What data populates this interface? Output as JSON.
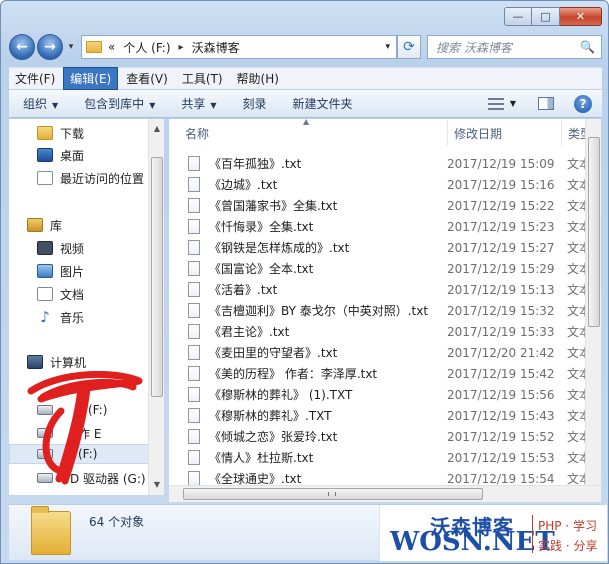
{
  "window": {
    "caption_buttons": [
      "—",
      "□",
      "✕"
    ]
  },
  "address": {
    "back": "←",
    "forward": "→",
    "history": "▾",
    "prefix": "«",
    "segments": [
      "个人 (F:)",
      "沃森博客"
    ],
    "separator": "▸",
    "dropdown": "▾",
    "refresh": "⟳"
  },
  "search": {
    "placeholder": "搜索 沃森博客",
    "icon": "🔍"
  },
  "menubar": {
    "items": [
      "文件(F)",
      "编辑(E)",
      "查看(V)",
      "工具(T)",
      "帮助(H)"
    ],
    "active_index": 1
  },
  "toolbar": {
    "items": [
      {
        "label": "组织",
        "arrow": "▼"
      },
      {
        "label": "包含到库中",
        "arrow": "▼"
      },
      {
        "label": "共享",
        "arrow": "▼"
      },
      {
        "label": "刻录",
        "arrow": ""
      },
      {
        "label": "新建文件夹",
        "arrow": ""
      }
    ],
    "view_arrow": "▼",
    "help_label": "?"
  },
  "nav": {
    "items": [
      {
        "label": "下载",
        "icon": "folder-icon",
        "group": "favorites"
      },
      {
        "label": "桌面",
        "icon": "desktop-icon",
        "group": "favorites"
      },
      {
        "label": "最近访问的位置",
        "icon": "recent-icon",
        "group": "favorites"
      },
      {
        "label": "库",
        "icon": "library-icon",
        "group": "libraries"
      },
      {
        "label": "视频",
        "icon": "video-icon",
        "group": "libraries"
      },
      {
        "label": "图片",
        "icon": "picture-icon",
        "group": "libraries"
      },
      {
        "label": "文档",
        "icon": "document-icon",
        "group": "libraries"
      },
      {
        "label": "音乐",
        "icon": "music-icon",
        "group": "libraries"
      },
      {
        "label": "计算机",
        "icon": "computer-icon",
        "group": "computer"
      },
      {
        "label": "本地磁盘 (C:)",
        "icon": "drive-icon",
        "group": "computer"
      },
      {
        "label": "工作 (E:)",
        "icon": "drive-icon",
        "group": "computer"
      },
      {
        "label": "个人 (F:)",
        "icon": "drive-icon",
        "group": "computer",
        "selected": true
      },
      {
        "label": "CD 驱动器 (G:)",
        "icon": "cd-drive-icon",
        "group": "computer"
      }
    ],
    "visible_fragments": [
      "(F:)",
      "作 E",
      "(F:)",
      "D 驱动器 (G:)"
    ]
  },
  "columns": {
    "name": "名称",
    "modified": "修改日期",
    "type": "类型"
  },
  "files": [
    {
      "name": "《百年孤独》.txt",
      "date": "2017/12/19 15:09",
      "type": "文本"
    },
    {
      "name": "《边城》.txt",
      "date": "2017/12/19 15:16",
      "type": "文本"
    },
    {
      "name": "《曾国藩家书》全集.txt",
      "date": "2017/12/19 15:22",
      "type": "文本"
    },
    {
      "name": "《忏悔录》全集.txt",
      "date": "2017/12/19 15:23",
      "type": "文本"
    },
    {
      "name": "《钢铁是怎样炼成的》.txt",
      "date": "2017/12/19 15:27",
      "type": "文本"
    },
    {
      "name": "《国富论》全本.txt",
      "date": "2017/12/19 15:29",
      "type": "文本"
    },
    {
      "name": "《活着》.txt",
      "date": "2017/12/19 15:13",
      "type": "文本"
    },
    {
      "name": "《吉檀迦利》BY 泰戈尔（中英对照）.txt",
      "date": "2017/12/19 15:32",
      "type": "文本"
    },
    {
      "name": "《君主论》.txt",
      "date": "2017/12/19 15:33",
      "type": "文本"
    },
    {
      "name": "《麦田里的守望者》.txt",
      "date": "2017/12/20 21:42",
      "type": "文本"
    },
    {
      "name": "《美的历程》 作者：李泽厚.txt",
      "date": "2017/12/19 15:42",
      "type": "文本"
    },
    {
      "name": "《穆斯林的葬礼》 (1).TXT",
      "date": "2017/12/19 15:56",
      "type": "文本"
    },
    {
      "name": "《穆斯林的葬礼》.TXT",
      "date": "2017/12/19 15:43",
      "type": "文本"
    },
    {
      "name": "《倾城之恋》张爱玲.txt",
      "date": "2017/12/19 15:52",
      "type": "文本"
    },
    {
      "name": "《情人》杜拉斯.txt",
      "date": "2017/12/19 15:53",
      "type": "文本"
    },
    {
      "name": "《全球通史》.txt",
      "date": "2017/12/19 15:54",
      "type": "文本"
    }
  ],
  "status": {
    "count": "64 个对象"
  },
  "watermark": {
    "cn": "沃森博客",
    "en": "WOSN.NET",
    "slogan1": "PHP · 学习",
    "slogan2": "实践 · 分享"
  },
  "colors": {
    "accent": "#3b76c2",
    "title_gradient_top": "#cfe0f3",
    "watermark_blue": "#1e4fa6",
    "watermark_red": "#c0392b",
    "scribble_red": "#e0201e"
  }
}
